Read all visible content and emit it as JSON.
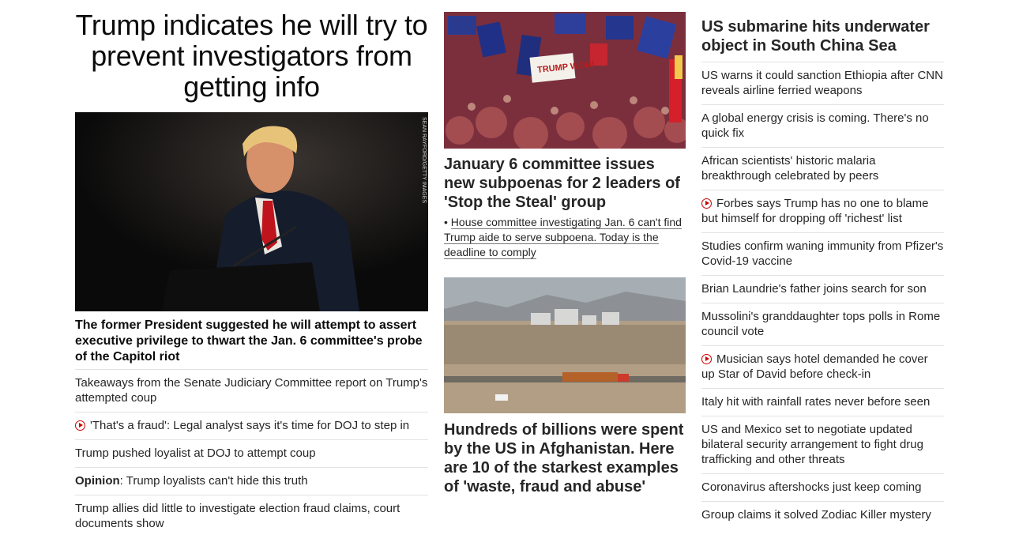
{
  "lead": {
    "title": "Trump indicates he will try to prevent investigators from getting info",
    "photo_credit": "SEAN RAYFORD/GETTY IMAGES",
    "caption": "The former President suggested he will attempt to assert executive privilege to thwart the Jan. 6 committee's probe of the Capitol riot",
    "items": [
      {
        "text": "Takeaways from the Senate Judiciary Committee report on Trump's attempted coup",
        "video": false
      },
      {
        "text": "'That's a fraud': Legal analyst says it's time for DOJ to step in",
        "video": true
      },
      {
        "text": "Trump pushed loyalist at DOJ to attempt coup",
        "video": false
      },
      {
        "prefix": "Opinion",
        "text": ": Trump loyalists can't hide this truth",
        "video": false
      },
      {
        "text": "Trump allies did little to investigate election fraud claims, court documents show",
        "video": false
      }
    ]
  },
  "middle": {
    "story1": {
      "photo_sign": "TRUMP WON!",
      "title": "January 6 committee issues new subpoenas for 2 leaders of 'Stop the Steal' group",
      "sub_bullet": "•",
      "sub": "House committee investigating Jan. 6 can't find Trump aide to serve subpoena. Today is the deadline to comply"
    },
    "story2": {
      "title": "Hundreds of billions were spent by the US in Afghanistan. Here are 10 of the starkest examples of 'waste, fraud and abuse'"
    }
  },
  "side": {
    "title": "US submarine hits underwater object in South China Sea",
    "items": [
      {
        "text": "US warns it could sanction Ethiopia after CNN reveals airline ferried weapons",
        "video": false
      },
      {
        "text": "A global energy crisis is coming. There's no quick fix",
        "video": false
      },
      {
        "text": "African scientists' historic malaria breakthrough celebrated by peers",
        "video": false
      },
      {
        "text": "Forbes says Trump has no one to blame but himself for dropping off 'richest' list",
        "video": true
      },
      {
        "text": "Studies confirm waning immunity from Pfizer's Covid-19 vaccine",
        "video": false
      },
      {
        "text": "Brian Laundrie's father joins search for son",
        "video": false
      },
      {
        "text": "Mussolini's granddaughter tops polls in Rome council vote",
        "video": false
      },
      {
        "text": "Musician says hotel demanded he cover up Star of David before check-in",
        "video": true
      },
      {
        "text": "Italy hit with rainfall rates never before seen",
        "video": false
      },
      {
        "text": "US and Mexico set to negotiate updated bilateral security arrangement to fight drug trafficking and other threats",
        "video": false
      },
      {
        "text": "Coronavirus aftershocks just keep coming",
        "video": false
      },
      {
        "text": "Group claims it solved Zodiac Killer mystery",
        "video": false
      }
    ]
  },
  "colors": {
    "video_red": "#cc0000",
    "divider": "#e2e2e2",
    "text": "#262626"
  }
}
